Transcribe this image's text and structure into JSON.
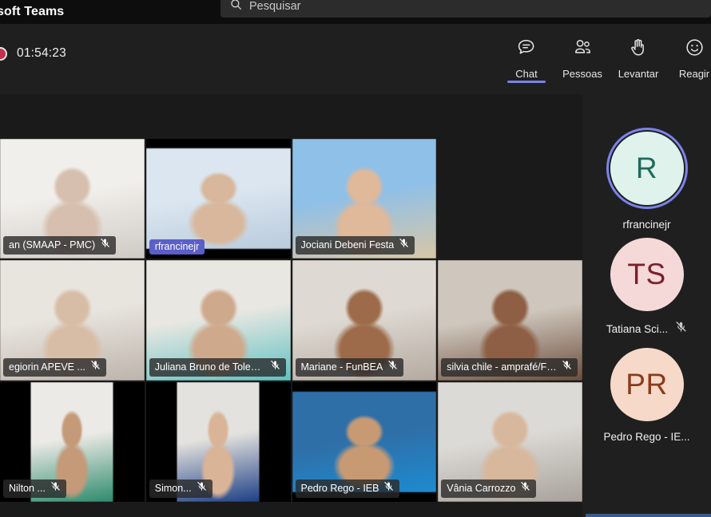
{
  "window": {
    "app_title": "soft Teams",
    "search": {
      "icon": "search-icon",
      "placeholder": "Pesquisar"
    }
  },
  "meeting": {
    "recording": {
      "icon": "record-indicator-icon",
      "elapsed": "01:54:23"
    },
    "toolbar": [
      {
        "id": "chat",
        "icon": "chat-icon",
        "label": "Chat",
        "active": true
      },
      {
        "id": "people",
        "icon": "people-icon",
        "label": "Pessoas",
        "active": false
      },
      {
        "id": "raise",
        "icon": "raise-hand-icon",
        "label": "Levantar",
        "active": false
      },
      {
        "id": "react",
        "icon": "reactions-icon",
        "label": "Reagir",
        "active": false
      }
    ]
  },
  "colors": {
    "accent": "#7b83eb",
    "speaking_badge": "#5b5fc7",
    "record": "#c4314b",
    "titlebar": "#0d0d0d",
    "toolbar_bg": "#1f1f1f",
    "stage_bg": "#1a1a1a"
  },
  "grid": {
    "tiles": [
      {
        "name": "an (SMAAP - PMC)",
        "muted": true,
        "speaking": false,
        "layout": "full",
        "kind": "video",
        "skin": "#d6bfae",
        "bg1": "#f1efeb",
        "bg2": "#cfcac4"
      },
      {
        "name": "rfrancinejr",
        "muted": false,
        "speaking": true,
        "layout": "letter",
        "kind": "video",
        "skin": "#d8b79c",
        "bg1": "#dbe6f0",
        "bg2": "#b9cbdd"
      },
      {
        "name": "Jociani Debeni Festa",
        "muted": true,
        "speaking": false,
        "layout": "full",
        "kind": "video",
        "skin": "#e0b89a",
        "bg1": "#8fc0e8",
        "bg2": "#d9c7a6"
      },
      {
        "name": "",
        "muted": false,
        "speaking": false,
        "layout": "full",
        "kind": "empty",
        "skin": "#000000",
        "bg1": "#1a1a1a",
        "bg2": "#1a1a1a"
      },
      {
        "name": "egiorin   APEVE ...",
        "muted": true,
        "speaking": false,
        "layout": "full",
        "kind": "video",
        "skin": "#d8bda6",
        "bg1": "#e8e4de",
        "bg2": "#bdb4ab"
      },
      {
        "name": "Juliana Bruno de Toledo Piz...",
        "muted": true,
        "speaking": false,
        "layout": "full",
        "kind": "video",
        "skin": "#cfa98c",
        "bg1": "#e9e7e2",
        "bg2": "#5fc2c2"
      },
      {
        "name": "Mariane - FunBEA",
        "muted": true,
        "speaking": false,
        "layout": "full",
        "kind": "video",
        "skin": "#9d6b4a",
        "bg1": "#ded9d2",
        "bg2": "#b4aaa0"
      },
      {
        "name": "silvia chile - amprafé/FPPPS ...",
        "muted": true,
        "speaking": false,
        "layout": "full",
        "kind": "video",
        "skin": "#8e5f44",
        "bg1": "#cfc7bd",
        "bg2": "#6d4e3c"
      },
      {
        "name": "Nilton ...",
        "muted": true,
        "speaking": false,
        "layout": "pillar",
        "kind": "video",
        "skin": "#c49a78",
        "bg1": "#eceae6",
        "bg2": "#2e8b6e"
      },
      {
        "name": "Simon...",
        "muted": true,
        "speaking": false,
        "layout": "pillar",
        "kind": "video",
        "skin": "#d9b496",
        "bg1": "#e4e2de",
        "bg2": "#1e3f86"
      },
      {
        "name": "Pedro Rego - IEB",
        "muted": true,
        "speaking": false,
        "layout": "letter",
        "kind": "video",
        "skin": "#c79a74",
        "bg1": "#2f6fa8",
        "bg2": "#1d8bd0"
      },
      {
        "name": "Vânia Carrozzo",
        "muted": true,
        "speaking": false,
        "layout": "full",
        "kind": "video",
        "skin": "#d8b89c",
        "bg1": "#dcdad6",
        "bg2": "#a8a29b"
      }
    ]
  },
  "roster": {
    "items": [
      {
        "initials": "R",
        "name": "rfrancinejr",
        "avatar_bg": "#dff3ec",
        "avatar_fg": "#1f6b5c",
        "speaking": true,
        "muted": false
      },
      {
        "initials": "TS",
        "name": "Tatiana Sci...",
        "avatar_bg": "#f5d9d9",
        "avatar_fg": "#7c1f29",
        "speaking": false,
        "muted": true
      },
      {
        "initials": "PR",
        "name": "Pedro Rego - IE...",
        "avatar_bg": "#f7d9c9",
        "avatar_fg": "#8a3b1c",
        "speaking": false,
        "muted": false
      }
    ]
  }
}
